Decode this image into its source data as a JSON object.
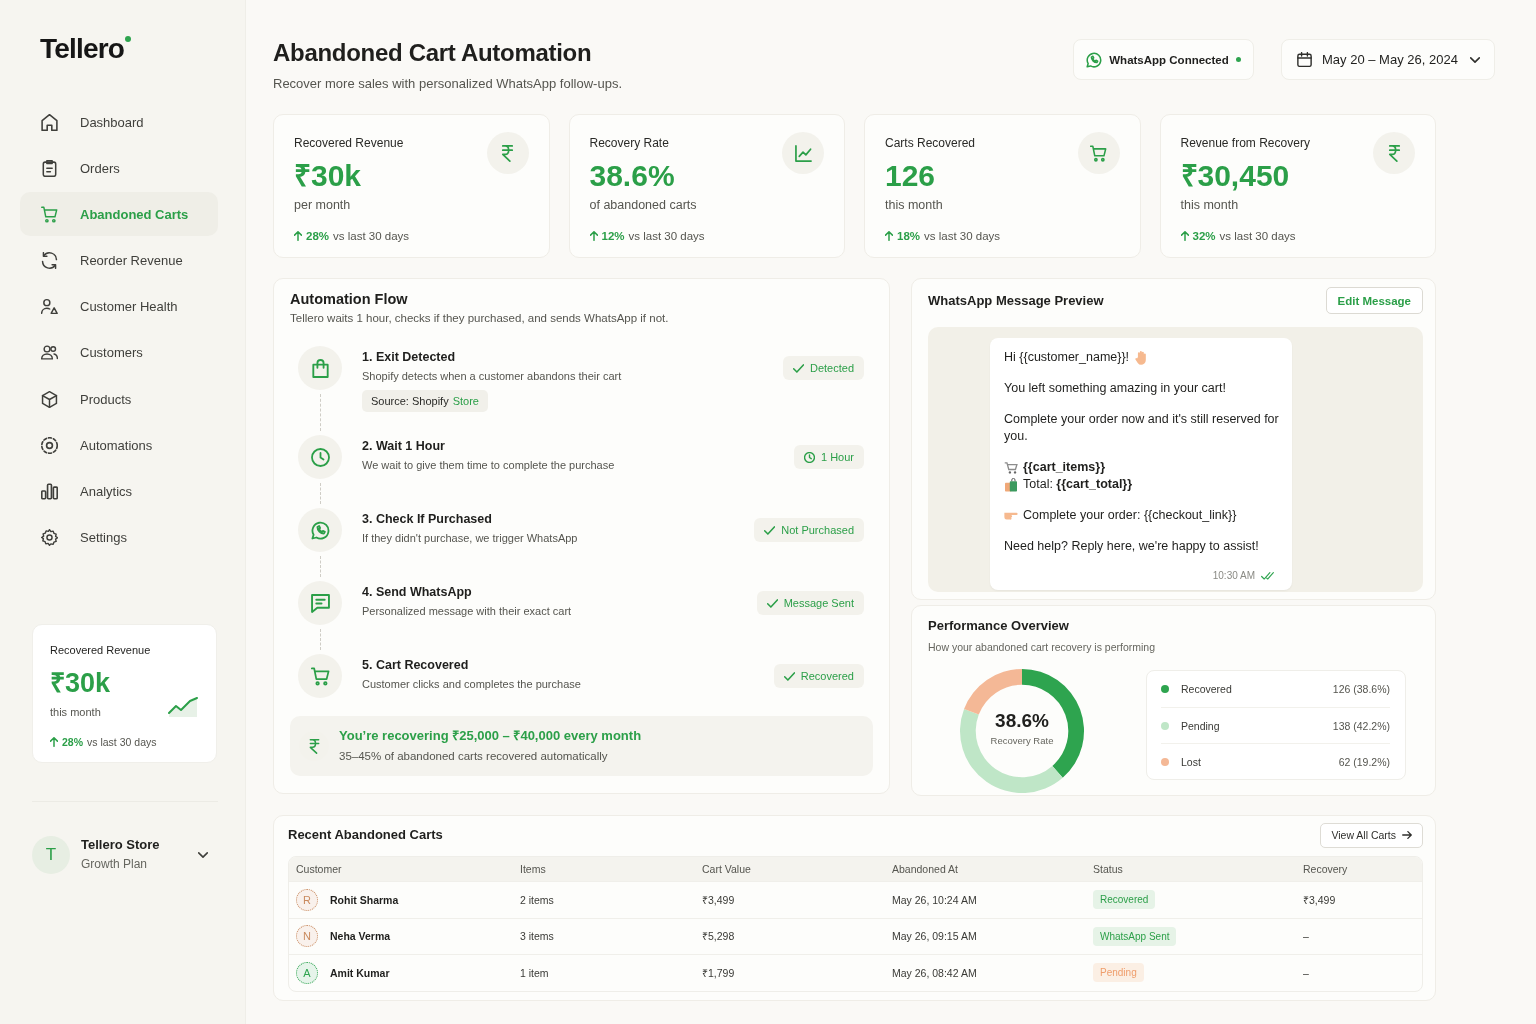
{
  "sidebar": {
    "logo": "Tellero",
    "nav": [
      {
        "label": "Dashboard",
        "kind": "dashboard",
        "selected": false
      },
      {
        "label": "Orders",
        "kind": "orders",
        "selected": false
      },
      {
        "label": "Abandoned Carts",
        "kind": "carts",
        "selected": true
      },
      {
        "label": "Reorder Revenue",
        "kind": "reorder",
        "selected": false
      },
      {
        "label": "Customer Health",
        "kind": "health",
        "selected": false
      },
      {
        "label": "Customers",
        "kind": "customers",
        "selected": false
      },
      {
        "label": "Products",
        "kind": "products",
        "selected": false
      },
      {
        "label": "Automations",
        "kind": "automations",
        "selected": false
      },
      {
        "label": "Analytics",
        "kind": "analytics",
        "selected": false
      },
      {
        "label": "Settings",
        "kind": "settings",
        "selected": false
      }
    ],
    "revenue_card": {
      "title": "Recovered Revenue",
      "value": "₹30k",
      "caption": "this month",
      "change": "28%",
      "change_note": "vs last 30 days"
    },
    "account": {
      "initial": "T",
      "name": "Tellero Store",
      "plan": "Growth Plan"
    }
  },
  "header": {
    "title": "Abandoned Cart Automation",
    "subtitle": "Recover more sales with personalized WhatsApp follow-ups.",
    "whatsapp_status": {
      "label": "WhatsApp Connected",
      "connected": true
    },
    "date_range": "May 20 – May 26, 2024"
  },
  "kpis": [
    {
      "kind": "revenue",
      "label": "Recovered Revenue",
      "value": "₹30k",
      "caption": "per month",
      "change": "28%",
      "change_note": "vs last 30 days"
    },
    {
      "kind": "rate",
      "label": "Recovery Rate",
      "value": "38.6%",
      "caption": "of abandoned carts",
      "change": "12%",
      "change_note": "vs last 30 days"
    },
    {
      "kind": "carts",
      "label": "Carts Recovered",
      "value": "126",
      "caption": "this month",
      "change": "18%",
      "change_note": "vs last 30 days"
    },
    {
      "kind": "revenue",
      "label": "Revenue from Recovery",
      "value": "₹30,450",
      "caption": "this month",
      "change": "32%",
      "change_note": "vs last 30 days"
    }
  ],
  "automation_flow": {
    "title": "Automation Flow",
    "subtitle": "Tellero waits 1 hour, checks if they purchased, and sends WhatsApp if not.",
    "steps": [
      {
        "kind": "exit",
        "title": "1. Exit Detected",
        "description": "Shopify detects when a customer abandons their cart",
        "source": {
          "label": "Source: Shopify",
          "value": "Store"
        },
        "status": {
          "kind": "check",
          "label": "Detected"
        }
      },
      {
        "kind": "wait",
        "title": "2. Wait 1 Hour",
        "description": "We wait to give them time to complete the purchase",
        "status": {
          "kind": "time",
          "label": "1 Hour"
        }
      },
      {
        "kind": "check",
        "title": "3. Check If Purchased",
        "description": "If they didn't purchase, we trigger WhatsApp",
        "status": {
          "kind": "check",
          "label": "Not Purchased"
        }
      },
      {
        "kind": "send",
        "title": "4. Send WhatsApp",
        "description": "Personalized message with their exact cart",
        "status": {
          "kind": "check",
          "label": "Message Sent"
        }
      },
      {
        "kind": "recovered",
        "title": "5. Cart Recovered",
        "description": "Customer clicks and completes the purchase",
        "status": {
          "kind": "check",
          "label": "Recovered"
        }
      }
    ],
    "summary": {
      "headline": "You’re recovering ₹25,000 – ₹40,000 every month",
      "note": "35–45% of abandoned carts recovered automatically"
    }
  },
  "message_preview": {
    "title": "WhatsApp Message Preview",
    "edit_button": "Edit Message",
    "lines": [
      {
        "kind": "greeting",
        "text": "Hi {{customer_name}}!"
      },
      {
        "kind": "text",
        "text": "You left something amazing in your cart!"
      },
      {
        "kind": "text",
        "text": "Complete your order now and it's still reserved for you."
      },
      {
        "kind": "items",
        "text": "{{cart_items}}"
      },
      {
        "kind": "total",
        "text": "Total: **{{cart_total}}**"
      },
      {
        "kind": "link",
        "text": "Complete your order: {{checkout_link}}"
      },
      {
        "kind": "text",
        "text": "Need help? Reply here, we're happy to assist!"
      }
    ],
    "time": "10:30 AM",
    "read": true
  },
  "performance": {
    "title": "Performance Overview",
    "subtitle": "How your abandoned cart recovery is performing",
    "center_value": "38.6%",
    "center_label": "Recovery Rate",
    "chart_data": {
      "type": "donut",
      "categories": [
        "Recovered",
        "Pending",
        "Lost"
      ],
      "values": [
        38.6,
        42.2,
        19.2
      ]
    },
    "legend": [
      {
        "reading": "126 (38.6%)",
        "color": "#2ea44f"
      },
      {
        "reading": "138 (42.2%)",
        "color": "#bfe6c7"
      },
      {
        "reading": "62 (19.2%)",
        "color": "#f4b896"
      }
    ]
  },
  "recent_carts": {
    "title": "Recent Abandoned Carts",
    "view_all": "View All Carts",
    "columns": [
      "Customer",
      "Items",
      "Cart Value",
      "Abandoned At",
      "Status",
      "Recovery"
    ],
    "rows": [
      {
        "avatar": {
          "initial": "R",
          "color": "#c98a5e"
        },
        "customer": "Rohit Sharma",
        "items": "2 items",
        "cart_value": "₹3,499",
        "abandoned_at": "May 26, 10:24 AM",
        "status": {
          "kind": "success",
          "label": "Recovered"
        },
        "recovery": "₹3,499"
      },
      {
        "avatar": {
          "initial": "N",
          "color": "#c98a5e"
        },
        "customer": "Neha Verma",
        "items": "3 items",
        "cart_value": "₹5,298",
        "abandoned_at": "May 26, 09:15 AM",
        "status": {
          "kind": "success",
          "label": "WhatsApp Sent"
        },
        "recovery": "–"
      },
      {
        "avatar": {
          "initial": "A",
          "color": "#2ea44f"
        },
        "customer": "Amit Kumar",
        "items": "1 item",
        "cart_value": "₹1,799",
        "abandoned_at": "May 26, 08:42 AM",
        "status": {
          "kind": "pending",
          "label": "Pending"
        },
        "recovery": "–"
      }
    ]
  }
}
